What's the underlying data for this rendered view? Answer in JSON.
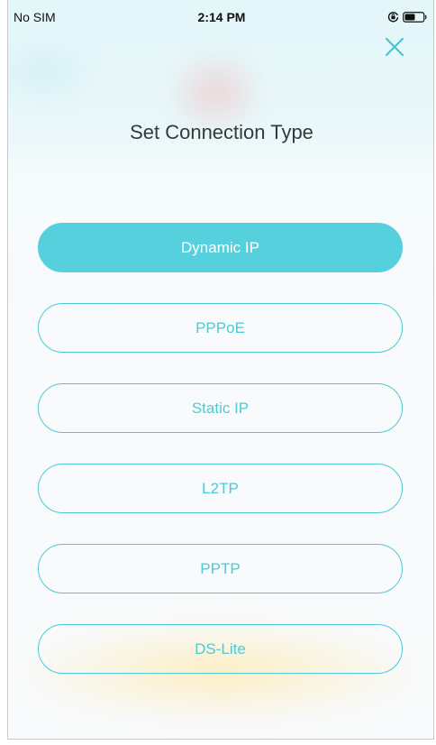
{
  "status_bar": {
    "carrier": "No SIM",
    "time": "2:14 PM",
    "icons": [
      "orientation-lock-icon",
      "battery-icon"
    ]
  },
  "header": {
    "title": "Set Connection Type",
    "close_icon": "close-icon"
  },
  "connection_types": [
    {
      "label": "Dynamic IP",
      "selected": true
    },
    {
      "label": "PPPoE",
      "selected": false
    },
    {
      "label": "Static IP",
      "selected": false
    },
    {
      "label": "L2TP",
      "selected": false
    },
    {
      "label": "PPTP",
      "selected": false
    },
    {
      "label": "DS-Lite",
      "selected": false
    }
  ],
  "colors": {
    "accent": "#55d0dc",
    "title_text": "#333a3d",
    "background_top": "#e3f6fa",
    "background": "#f8fafb"
  }
}
